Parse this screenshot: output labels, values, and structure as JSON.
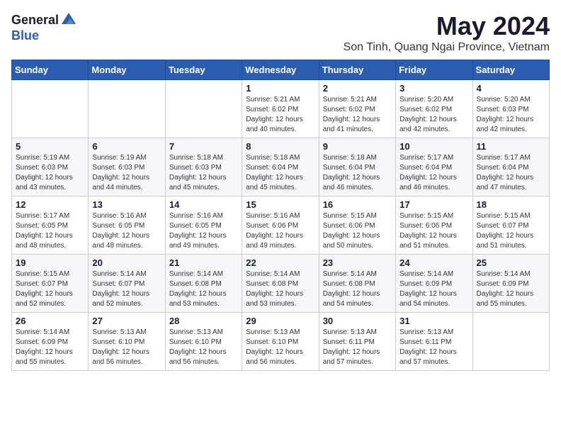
{
  "header": {
    "logo_general": "General",
    "logo_blue": "Blue",
    "month_title": "May 2024",
    "location": "Son Tinh, Quang Ngai Province, Vietnam"
  },
  "weekdays": [
    "Sunday",
    "Monday",
    "Tuesday",
    "Wednesday",
    "Thursday",
    "Friday",
    "Saturday"
  ],
  "weeks": [
    [
      {
        "day": "",
        "info": ""
      },
      {
        "day": "",
        "info": ""
      },
      {
        "day": "",
        "info": ""
      },
      {
        "day": "1",
        "info": "Sunrise: 5:21 AM\nSunset: 6:02 PM\nDaylight: 12 hours\nand 40 minutes."
      },
      {
        "day": "2",
        "info": "Sunrise: 5:21 AM\nSunset: 6:02 PM\nDaylight: 12 hours\nand 41 minutes."
      },
      {
        "day": "3",
        "info": "Sunrise: 5:20 AM\nSunset: 6:02 PM\nDaylight: 12 hours\nand 42 minutes."
      },
      {
        "day": "4",
        "info": "Sunrise: 5:20 AM\nSunset: 6:03 PM\nDaylight: 12 hours\nand 42 minutes."
      }
    ],
    [
      {
        "day": "5",
        "info": "Sunrise: 5:19 AM\nSunset: 6:03 PM\nDaylight: 12 hours\nand 43 minutes."
      },
      {
        "day": "6",
        "info": "Sunrise: 5:19 AM\nSunset: 6:03 PM\nDaylight: 12 hours\nand 44 minutes."
      },
      {
        "day": "7",
        "info": "Sunrise: 5:18 AM\nSunset: 6:03 PM\nDaylight: 12 hours\nand 45 minutes."
      },
      {
        "day": "8",
        "info": "Sunrise: 5:18 AM\nSunset: 6:04 PM\nDaylight: 12 hours\nand 45 minutes."
      },
      {
        "day": "9",
        "info": "Sunrise: 5:18 AM\nSunset: 6:04 PM\nDaylight: 12 hours\nand 46 minutes."
      },
      {
        "day": "10",
        "info": "Sunrise: 5:17 AM\nSunset: 6:04 PM\nDaylight: 12 hours\nand 46 minutes."
      },
      {
        "day": "11",
        "info": "Sunrise: 5:17 AM\nSunset: 6:04 PM\nDaylight: 12 hours\nand 47 minutes."
      }
    ],
    [
      {
        "day": "12",
        "info": "Sunrise: 5:17 AM\nSunset: 6:05 PM\nDaylight: 12 hours\nand 48 minutes."
      },
      {
        "day": "13",
        "info": "Sunrise: 5:16 AM\nSunset: 6:05 PM\nDaylight: 12 hours\nand 48 minutes."
      },
      {
        "day": "14",
        "info": "Sunrise: 5:16 AM\nSunset: 6:05 PM\nDaylight: 12 hours\nand 49 minutes."
      },
      {
        "day": "15",
        "info": "Sunrise: 5:16 AM\nSunset: 6:06 PM\nDaylight: 12 hours\nand 49 minutes."
      },
      {
        "day": "16",
        "info": "Sunrise: 5:15 AM\nSunset: 6:06 PM\nDaylight: 12 hours\nand 50 minutes."
      },
      {
        "day": "17",
        "info": "Sunrise: 5:15 AM\nSunset: 6:06 PM\nDaylight: 12 hours\nand 51 minutes."
      },
      {
        "day": "18",
        "info": "Sunrise: 5:15 AM\nSunset: 6:07 PM\nDaylight: 12 hours\nand 51 minutes."
      }
    ],
    [
      {
        "day": "19",
        "info": "Sunrise: 5:15 AM\nSunset: 6:07 PM\nDaylight: 12 hours\nand 52 minutes."
      },
      {
        "day": "20",
        "info": "Sunrise: 5:14 AM\nSunset: 6:07 PM\nDaylight: 12 hours\nand 52 minutes."
      },
      {
        "day": "21",
        "info": "Sunrise: 5:14 AM\nSunset: 6:08 PM\nDaylight: 12 hours\nand 53 minutes."
      },
      {
        "day": "22",
        "info": "Sunrise: 5:14 AM\nSunset: 6:08 PM\nDaylight: 12 hours\nand 53 minutes."
      },
      {
        "day": "23",
        "info": "Sunrise: 5:14 AM\nSunset: 6:08 PM\nDaylight: 12 hours\nand 54 minutes."
      },
      {
        "day": "24",
        "info": "Sunrise: 5:14 AM\nSunset: 6:09 PM\nDaylight: 12 hours\nand 54 minutes."
      },
      {
        "day": "25",
        "info": "Sunrise: 5:14 AM\nSunset: 6:09 PM\nDaylight: 12 hours\nand 55 minutes."
      }
    ],
    [
      {
        "day": "26",
        "info": "Sunrise: 5:14 AM\nSunset: 6:09 PM\nDaylight: 12 hours\nand 55 minutes."
      },
      {
        "day": "27",
        "info": "Sunrise: 5:13 AM\nSunset: 6:10 PM\nDaylight: 12 hours\nand 56 minutes."
      },
      {
        "day": "28",
        "info": "Sunrise: 5:13 AM\nSunset: 6:10 PM\nDaylight: 12 hours\nand 56 minutes."
      },
      {
        "day": "29",
        "info": "Sunrise: 5:13 AM\nSunset: 6:10 PM\nDaylight: 12 hours\nand 56 minutes."
      },
      {
        "day": "30",
        "info": "Sunrise: 5:13 AM\nSunset: 6:11 PM\nDaylight: 12 hours\nand 57 minutes."
      },
      {
        "day": "31",
        "info": "Sunrise: 5:13 AM\nSunset: 6:11 PM\nDaylight: 12 hours\nand 57 minutes."
      },
      {
        "day": "",
        "info": ""
      }
    ]
  ]
}
